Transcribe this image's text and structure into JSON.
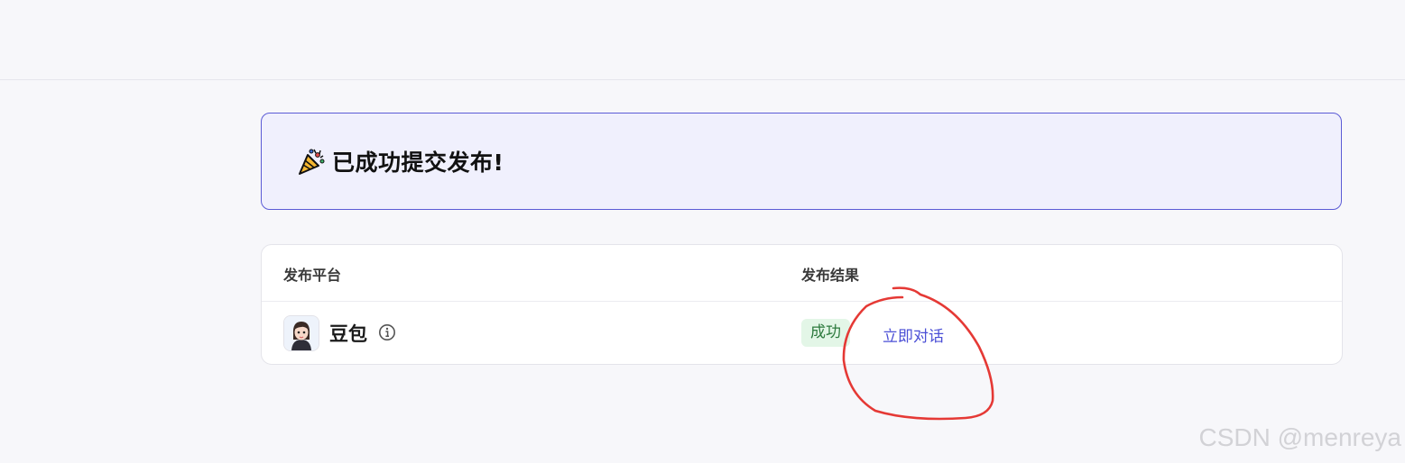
{
  "banner": {
    "icon": "party-popper-icon",
    "title": "已成功提交发布!"
  },
  "table": {
    "headers": {
      "platform": "发布平台",
      "result": "发布结果"
    },
    "rows": [
      {
        "platform_name": "豆包",
        "status": "成功",
        "action": "立即对话"
      }
    ]
  },
  "watermark": "CSDN @menreya",
  "colors": {
    "page_bg": "#f7f7fa",
    "banner_bg": "#f0f0fd",
    "banner_border": "#5b5bd6",
    "success_bg": "#e3f6e7",
    "success_text": "#2d7a3e",
    "link": "#4b4fd6",
    "annotation": "#e53935"
  }
}
